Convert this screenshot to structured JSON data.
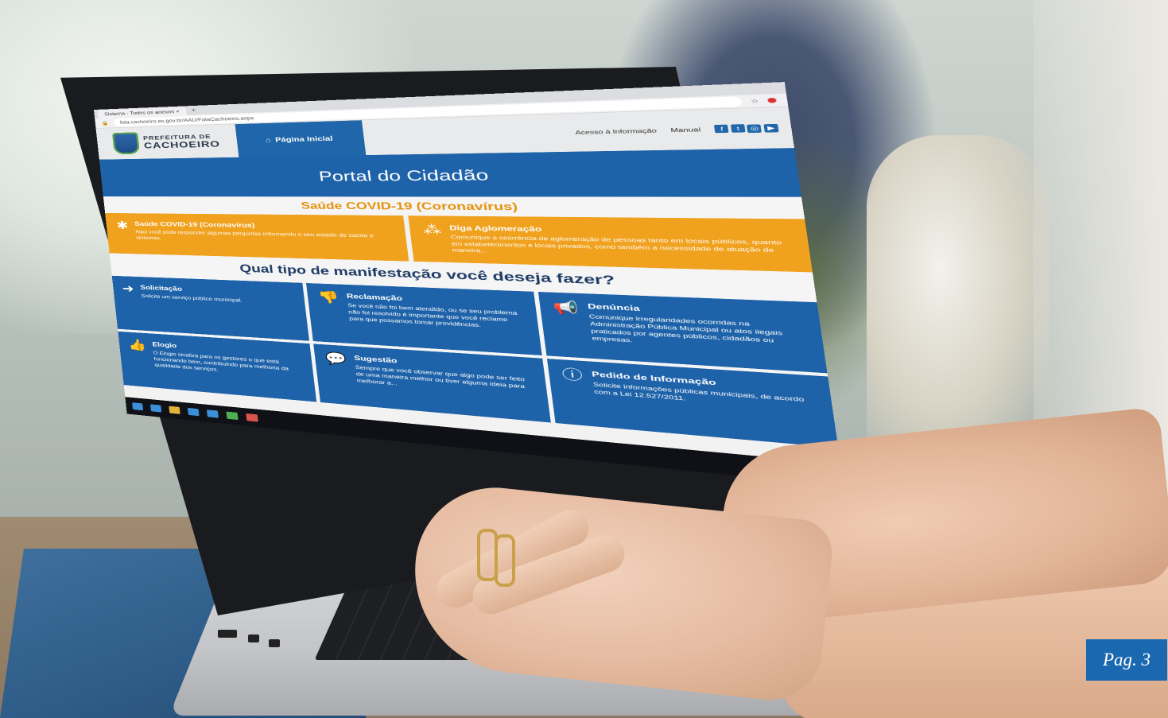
{
  "browser": {
    "tab_label": "Sistema - Todos os anexos",
    "tab_close": "×",
    "new_tab": "+",
    "url": "fala.cachoeiro.es.gov.br/AAU/FalaCachoeiro.aspx"
  },
  "site": {
    "logo_line1": "PREFEITURA DE",
    "logo_line2": "CACHOEIRO",
    "home_tab_icon": "home-icon",
    "home_tab": "Página Inicial",
    "header_links": [
      "Acesso à Informação",
      "Manual"
    ],
    "social_icons": [
      "facebook-icon",
      "twitter-icon",
      "instagram-icon",
      "youtube-icon"
    ],
    "portal_title": "Portal do Cidadão",
    "covid_section_title": "Saúde COVID-19 (Coronavírus)",
    "covid_cards": [
      {
        "title": "Saúde COVID-19 (Coronavírus)",
        "desc": "Aqui você pode responder algumas perguntas informando o seu estado de saúde e sintomas."
      },
      {
        "title": "Diga Aglomeração",
        "desc": "Comunique a ocorrência de aglomeração de pessoas tanto em locais públicos, quanto em estabelecimentos e locais privados, como também a necessidade de atuação de maneira..."
      }
    ],
    "question": "Qual tipo de manifestação você deseja fazer?",
    "manifestations": [
      {
        "title": "Solicitação",
        "desc": "Solicite um serviço público municipal."
      },
      {
        "title": "Reclamação",
        "desc": "Se você não foi bem atendido, ou se seu problema não foi resolvido é importante que você reclame para que possamos tomar providências."
      },
      {
        "title": "Denúncia",
        "desc": "Comunique irregularidades ocorridas na Administração Pública Municipal ou atos ilegais praticados por agentes públicos, cidadãos ou empresas."
      },
      {
        "title": "Elogio",
        "desc": "O Elogio sinaliza para os gestores o que está funcionando bem, contribuindo para melhoria da qualidade dos serviços."
      },
      {
        "title": "Sugestão",
        "desc": "Sempre que você observar que algo pode ser feito de uma maneira melhor ou tiver alguma ideia para melhorar a..."
      },
      {
        "title": "Pedido de Informação",
        "desc": "Solicite informações públicas municipais, de acordo com a Lei 12.527/2011."
      }
    ]
  },
  "page_badge": "Pag. 3",
  "colors": {
    "primary_blue": "#1e63a9",
    "covid_orange": "#f0a21f",
    "badge_blue": "#1a69b0"
  }
}
